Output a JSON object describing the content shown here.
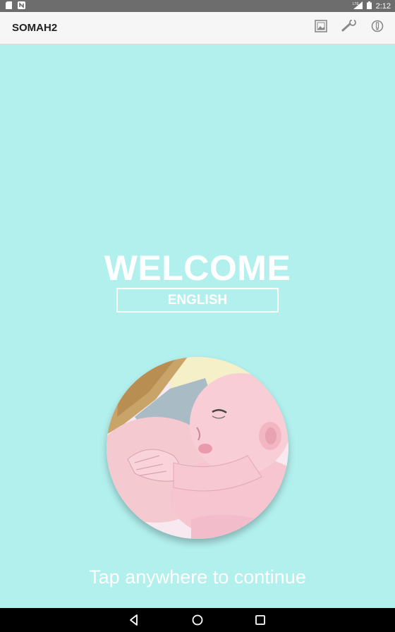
{
  "status_bar": {
    "time": "2:12",
    "icons": [
      "sd-card-icon",
      "n-notification-icon",
      "lte-signal-icon",
      "battery-icon"
    ]
  },
  "app_bar": {
    "title": "SOMAH2",
    "actions": [
      "gallery-icon",
      "wrench-icon",
      "info-icon"
    ]
  },
  "main": {
    "welcome_text": "WELCOME",
    "language_label": "ENGLISH",
    "illustration": "breastfeeding-baby-illustration",
    "tap_hint": "Tap anywhere to continue"
  },
  "nav_bar": {
    "buttons": [
      "back-icon",
      "home-icon",
      "recents-icon"
    ]
  },
  "colors": {
    "background": "#b2f0ee",
    "status_bar": "#6d6d6d",
    "app_bar": "#f6f6f6",
    "text_on_bg": "#ffffff"
  }
}
